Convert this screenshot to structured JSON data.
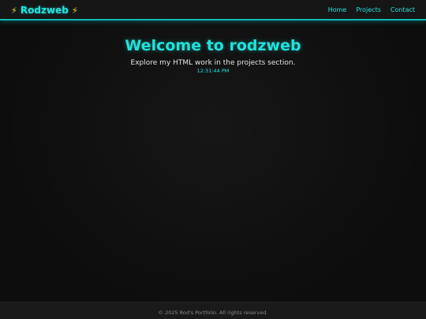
{
  "navbar": {
    "brand_bolt_left": "⚡",
    "brand_name": "Rodzweb",
    "brand_bolt_right": "⚡",
    "links": [
      {
        "label": "Home"
      },
      {
        "label": "Projects"
      },
      {
        "label": "Contact"
      }
    ]
  },
  "hero": {
    "title": "Welcome to rodzweb",
    "subtitle": "Explore my HTML work in the projects section.",
    "clock": "12:31:44 PM"
  },
  "footer": {
    "text": "© 2025 Rod's Portfolio. All rights reserved."
  },
  "colors": {
    "accent": "#1fe3dc",
    "bolt": "#f5c400",
    "background": "#0d0d0d"
  }
}
